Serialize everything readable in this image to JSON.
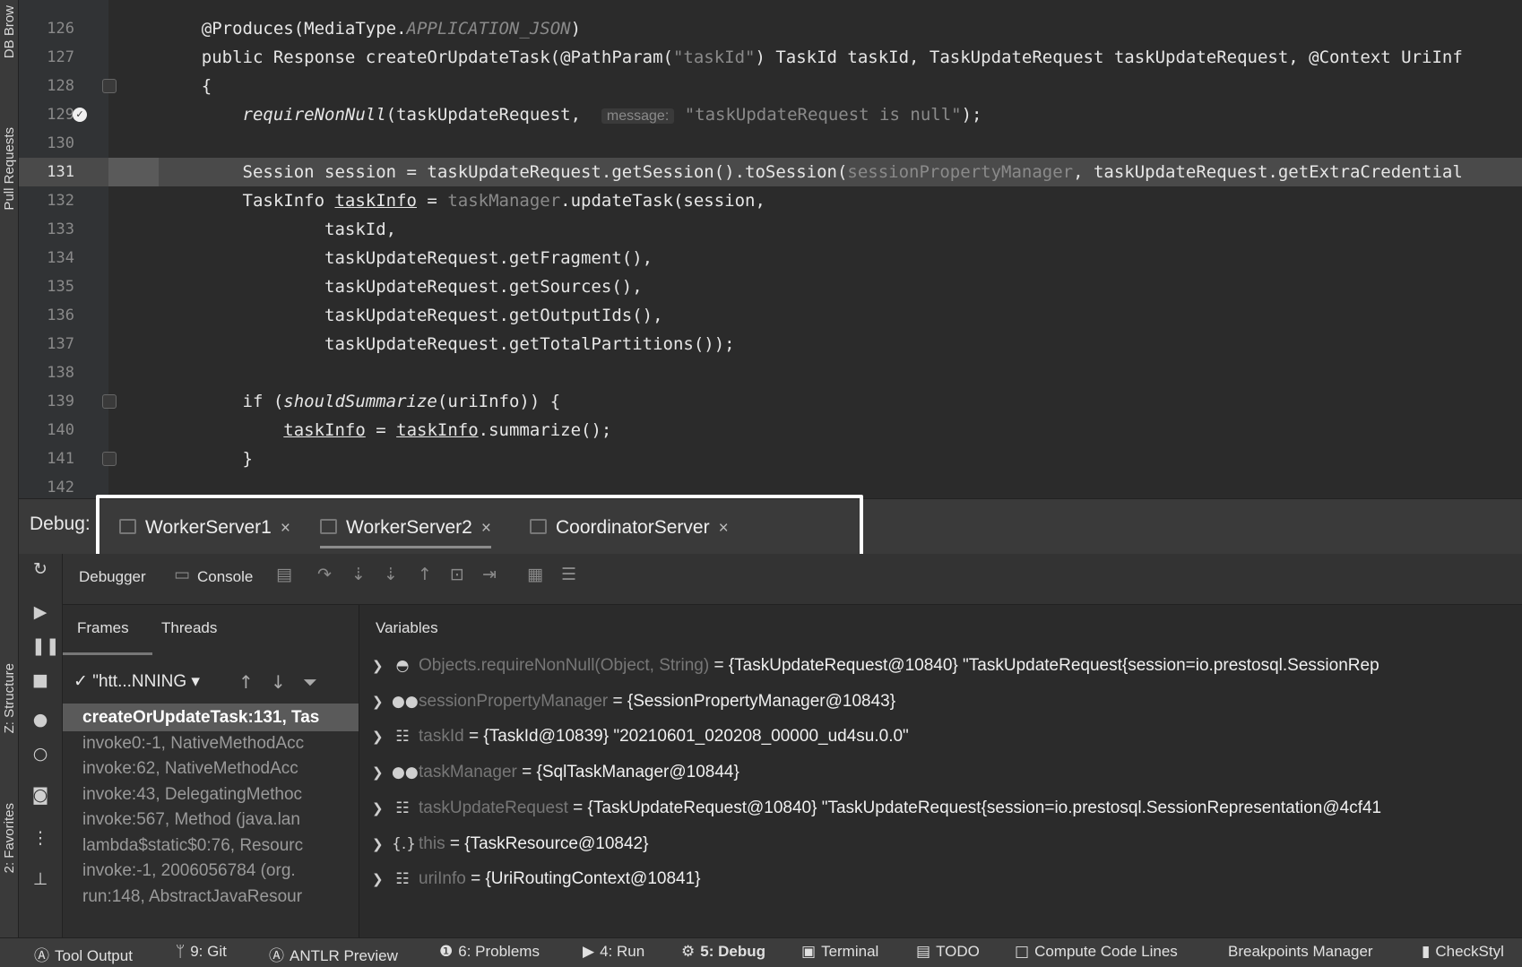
{
  "side_tabs": [
    "DB Brow",
    "Pull Requests",
    "Z: Structure",
    "2: Favorites"
  ],
  "editor": {
    "lines": [
      {
        "num": "126",
        "parts": [
          {
            "t": "    @Produces(MediaType."
          },
          {
            "t": "APPLICATION_JSON",
            "c": "dim it"
          },
          {
            "t": ")"
          }
        ]
      },
      {
        "num": "127",
        "parts": [
          {
            "t": "    public Response createOrUpdateTask(@PathParam("
          },
          {
            "t": "\"taskId\"",
            "c": "dim"
          },
          {
            "t": ") TaskId taskId, TaskUpdateRequest taskUpdateRequest, @Context UriInf"
          }
        ]
      },
      {
        "num": "128",
        "parts": [
          {
            "t": "    {"
          }
        ]
      },
      {
        "num": "129",
        "parts": [
          {
            "t": "        "
          },
          {
            "t": "requireNonNull",
            "c": "it"
          },
          {
            "t": "(taskUpdateRequest,  "
          },
          {
            "t": "message:",
            "c": "hint"
          },
          {
            "t": " "
          },
          {
            "t": "\"taskUpdateRequest is null\"",
            "c": "dim"
          },
          {
            "t": ");"
          }
        ]
      },
      {
        "num": "130",
        "parts": [
          {
            "t": ""
          }
        ]
      },
      {
        "num": "131",
        "parts": [
          {
            "t": "        Session session = taskUpdateRequest.getSession().toSession("
          },
          {
            "t": "sessionPropertyManager",
            "c": "dim"
          },
          {
            "t": ", taskUpdateRequest.getExtraCredential"
          }
        ]
      },
      {
        "num": "132",
        "parts": [
          {
            "t": "        TaskInfo "
          },
          {
            "t": "taskInfo",
            "c": "ul"
          },
          {
            "t": " = "
          },
          {
            "t": "taskManager",
            "c": "dim"
          },
          {
            "t": ".updateTask(session,"
          }
        ]
      },
      {
        "num": "133",
        "parts": [
          {
            "t": "                taskId,"
          }
        ]
      },
      {
        "num": "134",
        "parts": [
          {
            "t": "                taskUpdateRequest.getFragment(),"
          }
        ]
      },
      {
        "num": "135",
        "parts": [
          {
            "t": "                taskUpdateRequest.getSources(),"
          }
        ]
      },
      {
        "num": "136",
        "parts": [
          {
            "t": "                taskUpdateRequest.getOutputIds(),"
          }
        ]
      },
      {
        "num": "137",
        "parts": [
          {
            "t": "                taskUpdateRequest.getTotalPartitions());"
          }
        ]
      },
      {
        "num": "138",
        "parts": [
          {
            "t": ""
          }
        ]
      },
      {
        "num": "139",
        "parts": [
          {
            "t": "        if ("
          },
          {
            "t": "shouldSummarize",
            "c": "it"
          },
          {
            "t": "(uriInfo)) {"
          }
        ]
      },
      {
        "num": "140",
        "parts": [
          {
            "t": "            "
          },
          {
            "t": "taskInfo",
            "c": "ul"
          },
          {
            "t": " = "
          },
          {
            "t": "taskInfo",
            "c": "ul"
          },
          {
            "t": ".summarize();"
          }
        ]
      },
      {
        "num": "141",
        "parts": [
          {
            "t": "        }"
          }
        ]
      },
      {
        "num": "142",
        "parts": [
          {
            "t": ""
          }
        ]
      }
    ]
  },
  "debug": {
    "label": "Debug:",
    "tabs": [
      "WorkerServer1",
      "WorkerServer2",
      "CoordinatorServer"
    ],
    "active_tab": "WorkerServer2"
  },
  "toolbar": {
    "debugger_label": "Debugger",
    "console_label": "Console"
  },
  "frames_panel": {
    "frames_tab": "Frames",
    "threads_tab": "Threads",
    "thread_selector": "\"htt...NNING",
    "frames": [
      "createOrUpdateTask:131, Tas",
      "invoke0:-1, NativeMethodAcc",
      "invoke:62, NativeMethodAcc",
      "invoke:43, DelegatingMethoc",
      "invoke:567, Method (java.lan",
      "lambda$static$0:76, Resourc",
      "invoke:-1, 2006056784 (org.",
      "run:148, AbstractJavaResour"
    ]
  },
  "variables_panel": {
    "title": "Variables",
    "rows": [
      {
        "icon": "watch-icon",
        "name": "Objects.requireNonNull(Object, String)",
        "value": " = {TaskUpdateRequest@10840} \"TaskUpdateRequest{session=io.prestosql.SessionRep"
      },
      {
        "icon": "glasses-icon",
        "name": "sessionPropertyManager",
        "value": " = {SessionPropertyManager@10843}"
      },
      {
        "icon": "field-icon",
        "name": "taskId",
        "value": " = {TaskId@10839} \"20210601_020208_00000_ud4su.0.0\""
      },
      {
        "icon": "glasses-icon",
        "name": "taskManager",
        "value": " = {SqlTaskManager@10844}"
      },
      {
        "icon": "field-icon",
        "name": "taskUpdateRequest",
        "value": " = {TaskUpdateRequest@10840} \"TaskUpdateRequest{session=io.prestosql.SessionRepresentation@4cf41"
      },
      {
        "icon": "this-icon",
        "name": "this",
        "value": " = {TaskResource@10842}"
      },
      {
        "icon": "field-icon",
        "name": "uriInfo",
        "value": " = {UriRoutingContext@10841}"
      }
    ]
  },
  "statusbar": {
    "items": [
      "Tool Output",
      "9: Git",
      "ANTLR Preview",
      "6: Problems",
      "4: Run",
      "5: Debug",
      "Terminal",
      "TODO",
      "Compute Code Lines",
      "Breakpoints Manager",
      "CheckStyl"
    ],
    "active": "5: Debug"
  }
}
